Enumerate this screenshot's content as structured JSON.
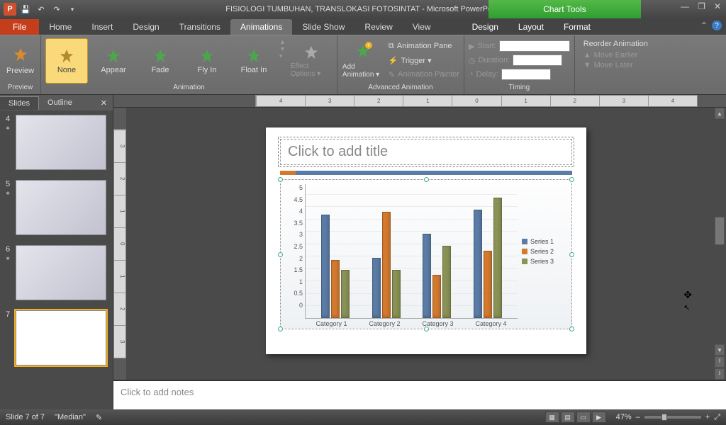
{
  "qat": {
    "save_tip": "Save",
    "undo_tip": "Undo",
    "redo_tip": "Redo"
  },
  "title": "FISIOLOGI TUMBUHAN, TRANSLOKASI FOTOSINTAT  -  Microsoft PowerPoint",
  "chart_tools_label": "Chart Tools",
  "win": {
    "min": "—",
    "max": "❐",
    "close": "✕"
  },
  "tabs": {
    "file": "File",
    "home": "Home",
    "insert": "Insert",
    "design": "Design",
    "transitions": "Transitions",
    "animations": "Animations",
    "slideshow": "Slide Show",
    "review": "Review",
    "view": "View",
    "chart_design": "Design",
    "chart_layout": "Layout",
    "chart_format": "Format"
  },
  "ribbon": {
    "preview_group": "Preview",
    "preview": "Preview",
    "animation_group": "Animation",
    "anim_none": "None",
    "anim_appear": "Appear",
    "anim_fade": "Fade",
    "anim_flyin": "Fly In",
    "anim_floatin": "Float In",
    "effect_options": "Effect Options ▾",
    "advanced_group": "Advanced Animation",
    "add_animation": "Add Animation ▾",
    "animation_pane": "Animation Pane",
    "trigger": "Trigger ▾",
    "animation_painter": "Animation Painter",
    "timing_group": "Timing",
    "start": "Start:",
    "duration": "Duration:",
    "delay": "Delay:",
    "reorder_hdr": "Reorder Animation",
    "move_earlier": "Move Earlier",
    "move_later": "Move Later"
  },
  "slidepanel": {
    "slides_tab": "Slides",
    "outline_tab": "Outline",
    "thumbs": [
      {
        "num": "4"
      },
      {
        "num": "5"
      },
      {
        "num": "6"
      },
      {
        "num": "7"
      }
    ]
  },
  "slide": {
    "title_placeholder": "Click to add title"
  },
  "chart_data": {
    "type": "bar",
    "categories": [
      "Category 1",
      "Category 2",
      "Category 3",
      "Category 4"
    ],
    "series": [
      {
        "name": "Series 1",
        "values": [
          4.3,
          2.5,
          3.5,
          4.5
        ]
      },
      {
        "name": "Series 2",
        "values": [
          2.4,
          4.4,
          1.8,
          2.8
        ]
      },
      {
        "name": "Series 3",
        "values": [
          2.0,
          2.0,
          3.0,
          5.0
        ]
      }
    ],
    "ylim": [
      0,
      5
    ],
    "yticks": [
      "0",
      "0.5",
      "1",
      "1.5",
      "2",
      "2.5",
      "3",
      "3.5",
      "4",
      "4.5",
      "5"
    ],
    "xlabel": "",
    "ylabel": "",
    "title": ""
  },
  "notes_placeholder": "Click to add notes",
  "status": {
    "slide_of": "Slide 7 of 7",
    "theme": "\"Median\"",
    "zoom_pct": "47%",
    "zoom_out": "–",
    "zoom_in": "+",
    "fit": "⤢"
  },
  "ruler_h": [
    "4",
    "3",
    "2",
    "1",
    "0",
    "1",
    "2",
    "3",
    "4"
  ],
  "ruler_v": [
    "3",
    "2",
    "1",
    "0",
    "1",
    "2",
    "3"
  ]
}
